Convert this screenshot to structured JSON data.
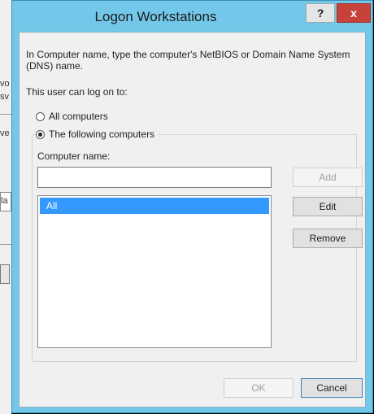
{
  "background_window": {
    "fragments": [
      "vo",
      "sv",
      "ve",
      "la"
    ]
  },
  "dialog": {
    "title": "Logon Workstations",
    "help_label": "?",
    "close_label": "x",
    "intro": "In Computer name, type the computer's NetBIOS or Domain Name System (DNS) name.",
    "logon_label": "This user can log on to:",
    "options": {
      "all": "All computers",
      "following": "The following computers"
    },
    "selected_option": "following",
    "computer_name_label": "Computer name:",
    "computer_name_value": "",
    "computers": [
      "All"
    ],
    "buttons": {
      "add": "Add",
      "edit": "Edit",
      "remove": "Remove",
      "ok": "OK",
      "cancel": "Cancel"
    }
  },
  "colors": {
    "title_bar": "#73c8ea",
    "close_button": "#c7433a",
    "selection": "#3399ff"
  }
}
